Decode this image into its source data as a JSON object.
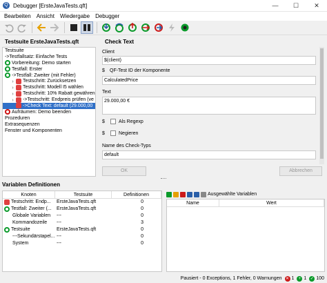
{
  "window": {
    "title": "Debugger [ErsteJavaTests.qft]"
  },
  "menu": [
    "Bearbeiten",
    "Ansicht",
    "Wiedergabe",
    "Debugger"
  ],
  "toolbar": {
    "icons": [
      "undo-icon",
      "redo-icon",
      "back-icon",
      "forward-icon",
      "stop-icon",
      "pause-icon",
      "step-in-icon",
      "step-over-icon",
      "step-out-icon",
      "skip-icon",
      "continue-icon",
      "break-icon",
      "breakpoint-icon"
    ],
    "colors": {
      "green": "#0a9a2a",
      "red": "#cc1a1a",
      "blue": "#2a5fa8",
      "orange": "#e5a000"
    }
  },
  "tree": {
    "header": "Testsuite ErsteJavaTests.qft",
    "rows": [
      {
        "indent": 0,
        "icon": "none",
        "text": "Testsuite",
        "bold": false
      },
      {
        "indent": 0,
        "icon": "none",
        "text": "->Testfallsatz: Einfache Tests",
        "bold": false
      },
      {
        "indent": 0,
        "icon": "setup-icon",
        "text": "Vorbereitung: Demo starten",
        "bold": false
      },
      {
        "indent": 0,
        "icon": "testcase-icon",
        "text": "Testfall: Erster",
        "bold": false
      },
      {
        "indent": 0,
        "icon": "testcase-icon",
        "text": "->Testfall: Zweiter (mit Fehler)",
        "bold": false
      },
      {
        "indent": 1,
        "icon": "step-icon",
        "text": "Testschritt: Zurücksetzen",
        "bold": false
      },
      {
        "indent": 1,
        "icon": "step-icon",
        "text": "Testschritt: Modell I5 wählen",
        "bold": false
      },
      {
        "indent": 1,
        "icon": "step-icon",
        "text": "Testschritt: 10% Rabatt gewähren",
        "bold": false
      },
      {
        "indent": 1,
        "icon": "step-icon",
        "text": "->Testschritt: Endpreis prüfen (ve",
        "bold": false
      },
      {
        "indent": 2,
        "icon": "check-icon",
        "text": "->Check Text: default (29.000,00",
        "bold": false,
        "selected": true
      },
      {
        "indent": 0,
        "icon": "cleanup-icon",
        "text": "Aufräumen: Demo beenden",
        "bold": false
      },
      {
        "indent": 0,
        "icon": "none",
        "text": "Prozeduren",
        "bold": false
      },
      {
        "indent": 0,
        "icon": "none",
        "text": "Extrasequenzen",
        "bold": false
      },
      {
        "indent": 0,
        "icon": "none",
        "text": "Fenster und Komponenten",
        "bold": false
      }
    ]
  },
  "detail": {
    "header": "Check Text",
    "client_label": "Client",
    "client_value": "$(client)",
    "component_label": "QF-Test ID der Komponente",
    "component_value": "CalculatedPrice",
    "text_label": "Text",
    "text_value": "29.000,00 €",
    "regexp_label": "Als Regexp",
    "negate_label": "Negieren",
    "checktype_label": "Name des Check-Typs",
    "checktype_value": "default",
    "ok_label": "OK",
    "cancel_label": "Abbrechen"
  },
  "variables": {
    "header": "Variablen Definitionen",
    "columns": [
      "Knoten",
      "Testsuite",
      "Definitionen"
    ],
    "rows": [
      {
        "node": "Testschritt: Endp...",
        "suite": "ErsteJavaTests.qft",
        "defs": "0",
        "icon": "step-icon"
      },
      {
        "node": "Testfall: Zweiter (...",
        "suite": "ErsteJavaTests.qft",
        "defs": "0",
        "icon": "testcase-icon"
      },
      {
        "node": "Globale Variablen",
        "suite": "---",
        "defs": "0",
        "icon": "none"
      },
      {
        "node": "Kommandozeile",
        "suite": "---",
        "defs": "3",
        "icon": "none"
      },
      {
        "node": "Testsuite",
        "suite": "ErsteJavaTests.qft",
        "defs": "0",
        "icon": "suite-icon"
      },
      {
        "node": "---Sekundärstapel...",
        "suite": "---",
        "defs": "0",
        "icon": "none"
      },
      {
        "node": "System",
        "suite": "---",
        "defs": "0",
        "icon": "none"
      }
    ],
    "right_label": "Ausgewählte Variablen",
    "right_columns": [
      "Name",
      "Wert"
    ]
  },
  "status": {
    "text": "Pausiert - 0 Exceptions, 1 Fehler, 0 Warnungen",
    "count_red": "1",
    "count_green": "1",
    "count_total": "100"
  }
}
